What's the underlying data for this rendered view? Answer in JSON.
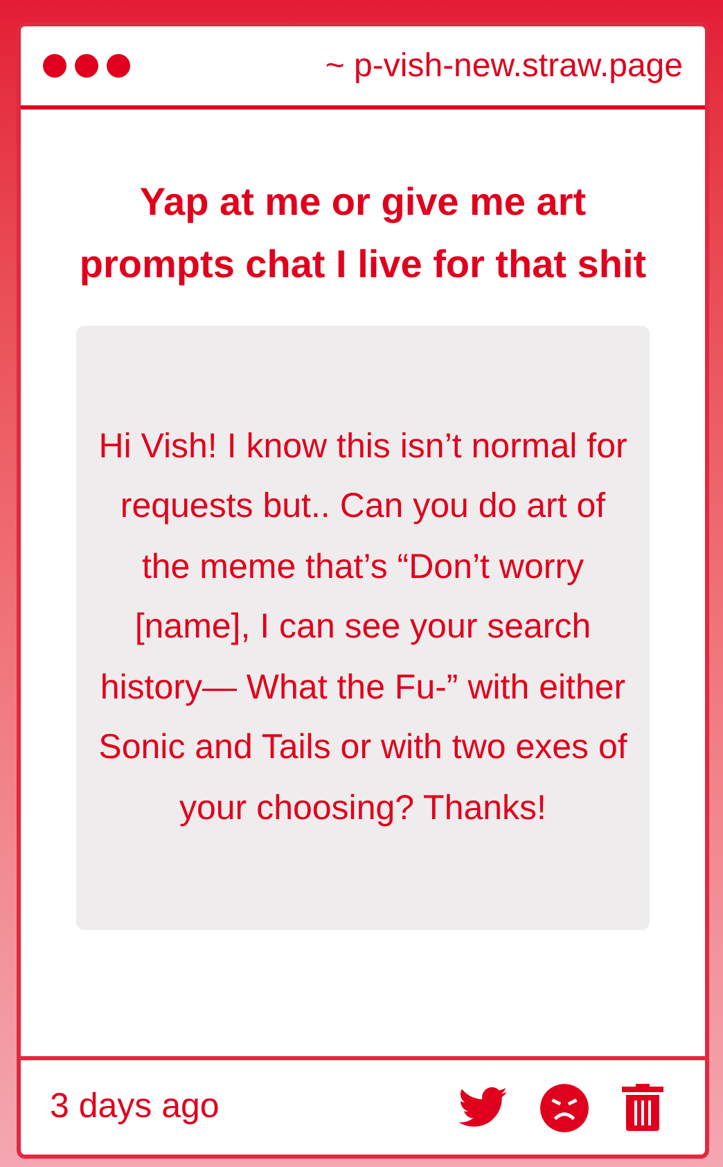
{
  "window": {
    "url": "~ p-vish-new.straw.page"
  },
  "prompt": {
    "title": "Yap at me or give me art prompts chat I live for that shit"
  },
  "message": {
    "text": "Hi Vish! I know this isn’t normal for requests but.. Can you do art of the meme that’s “Don’t worry [name], I can see your search history— What the Fu-” with either Sonic and Tails or with two exes of your choosing? Thanks!"
  },
  "footer": {
    "time": "3 days ago"
  }
}
